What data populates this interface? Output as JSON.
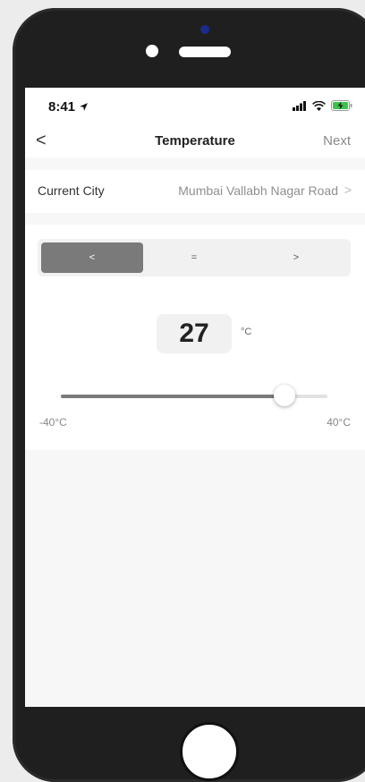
{
  "status_bar": {
    "time": "8:41"
  },
  "nav": {
    "title": "Temperature",
    "next_label": "Next",
    "back_glyph": "<"
  },
  "city": {
    "label": "Current City",
    "value": "Mumbai Vallabh Nagar Road",
    "chevron": ">"
  },
  "condition": {
    "options": [
      "<",
      "=",
      ">"
    ],
    "selected_index": 0
  },
  "temperature": {
    "value": "27",
    "unit": "°C",
    "min_label": "-40°C",
    "max_label": "40°C",
    "slider_fraction": 0.84
  },
  "colors": {
    "accent": "#7a7a7a",
    "battery": "#3cc34a"
  },
  "icons": [
    "location-arrow-icon",
    "signal-icon",
    "wifi-icon",
    "battery-charging-icon",
    "back-chevron-icon",
    "chevron-right-icon"
  ]
}
